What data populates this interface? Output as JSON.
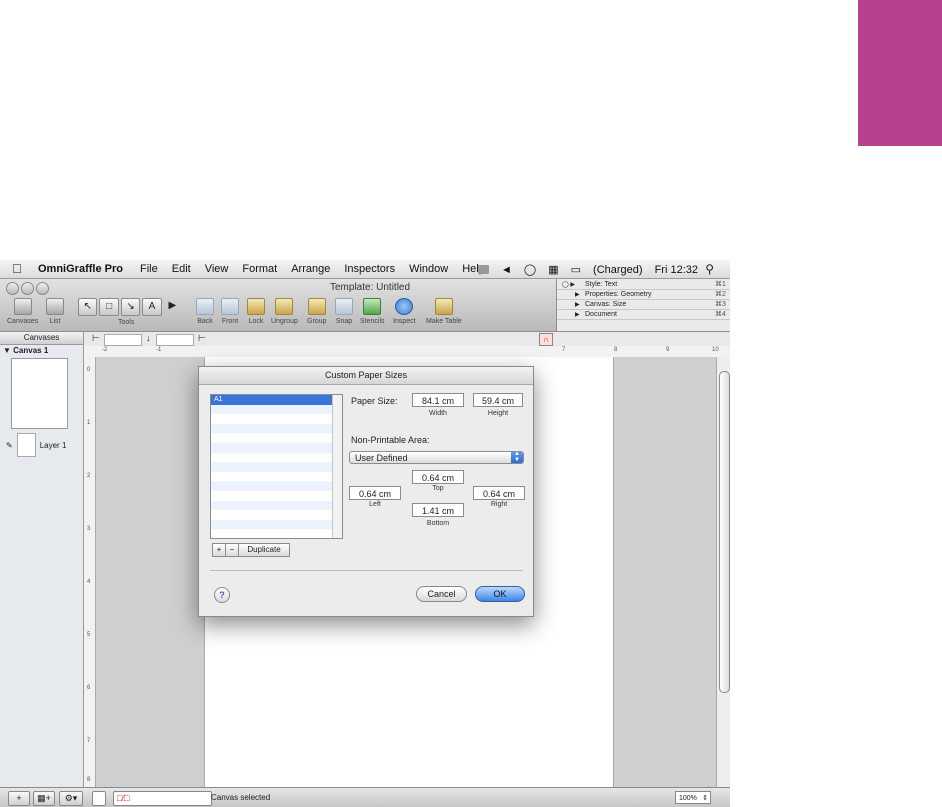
{
  "menubar": {
    "apple_icon": "apple-icon",
    "app_name": "OmniGraffle Pro",
    "menus": [
      "File",
      "Edit",
      "View",
      "Format",
      "Arrange",
      "Inspectors",
      "Window",
      "Help"
    ],
    "battery_text": "(Charged)",
    "clock": "Fri 12:32"
  },
  "window": {
    "title": "Template: Untitled",
    "toolbar": {
      "canvases_label": "Canvases",
      "list_label": "List",
      "tools_label": "Tools",
      "back_label": "Back",
      "front_label": "Front",
      "lock_label": "Lock",
      "ungroup_label": "Ungroup",
      "group_label": "Group",
      "snap_label": "Snap",
      "stencils_label": "Stencils",
      "inspect_label": "Inspect",
      "make_table_label": "Make Table"
    },
    "inspector": {
      "rows": [
        {
          "label": "Style: Text",
          "key": "⌘1"
        },
        {
          "label": "Properties: Geometry",
          "key": "⌘2"
        },
        {
          "label": "Canvas: Size",
          "key": "⌘3"
        },
        {
          "label": "Document",
          "key": "⌘4"
        }
      ]
    }
  },
  "sidebar": {
    "header": "Canvases",
    "canvas_name": "Canvas 1",
    "layer_name": "Layer 1"
  },
  "ruler": {
    "h_ticks": [
      "-2",
      "-1",
      "7",
      "8",
      "9",
      "10"
    ],
    "v_ticks": [
      "0",
      "1",
      "2",
      "3",
      "4",
      "5",
      "6",
      "7",
      "8"
    ]
  },
  "dialog": {
    "title": "Custom Paper Sizes",
    "list_items": [
      "A1"
    ],
    "add_label": "+",
    "remove_label": "−",
    "duplicate_label": "Duplicate",
    "paper_size_label": "Paper Size:",
    "width_value": "84.1 cm",
    "width_label": "Width",
    "height_value": "59.4 cm",
    "height_label": "Height",
    "non_printable_label": "Non-Printable Area:",
    "area_select": "User Defined",
    "top_value": "0.64 cm",
    "top_label": "Top",
    "left_value": "0.64 cm",
    "left_label": "Left",
    "right_value": "0.64 cm",
    "right_label": "Right",
    "bottom_value": "1.41 cm",
    "bottom_label": "Bottom",
    "help_label": "?",
    "cancel_label": "Cancel",
    "ok_label": "OK"
  },
  "statusbar": {
    "status_text": "Canvas selected",
    "zoom": "100%"
  },
  "colors": {
    "accent_tab": "#b8418f",
    "selection": "#3875d7"
  }
}
